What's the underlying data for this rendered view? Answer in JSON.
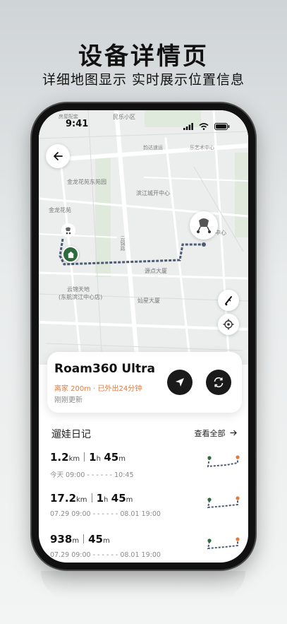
{
  "promo": {
    "title": "设备详情页",
    "subtitle": "详细地图显示 实时展示位置信息"
  },
  "status_bar": {
    "time": "9:41"
  },
  "map": {
    "labels": [
      "民乐小区",
      "房屋配套",
      "韵达速运",
      "金龙花苑东苑园",
      "滨江城开中心",
      "金龙花苑",
      "云锦路",
      "源点大厦",
      "云锦天地",
      "(东航滨江中心店)",
      "灿星大厦",
      "中心",
      "乐艺术中心"
    ],
    "route_color": "#4d5b75"
  },
  "device": {
    "name": "Roam360 Ultra",
    "status": "离家 200m · 已外出24分钟",
    "updated": "刚刚更新",
    "accent_color": "#e27a3f"
  },
  "diary": {
    "title": "遛娃日记",
    "view_all": "查看全部",
    "entries": [
      {
        "dist_value": "1.2",
        "dist_unit": "km",
        "h_value": "1",
        "h_unit": "h",
        "m_value": "45",
        "m_unit": "m",
        "start": "今天 09:00",
        "end": "10:45"
      },
      {
        "dist_value": "17.2",
        "dist_unit": "km",
        "h_value": "1",
        "h_unit": "h",
        "m_value": "45",
        "m_unit": "m",
        "start": "07.29 09:00",
        "end": "08.01 19:00"
      },
      {
        "dist_value": "938",
        "dist_unit": "m",
        "h_value": "",
        "h_unit": "",
        "m_value": "45",
        "m_unit": "m",
        "start": "07.29 09:00",
        "end": "08.01 19:00"
      }
    ]
  },
  "icons": [
    "back-arrow-icon",
    "stroller-icon",
    "home-icon",
    "stroller-toggle-icon",
    "locate-icon",
    "navigate-icon",
    "refresh-icon",
    "chevron-right-icon",
    "signal-icon",
    "wifi-icon",
    "battery-icon"
  ]
}
